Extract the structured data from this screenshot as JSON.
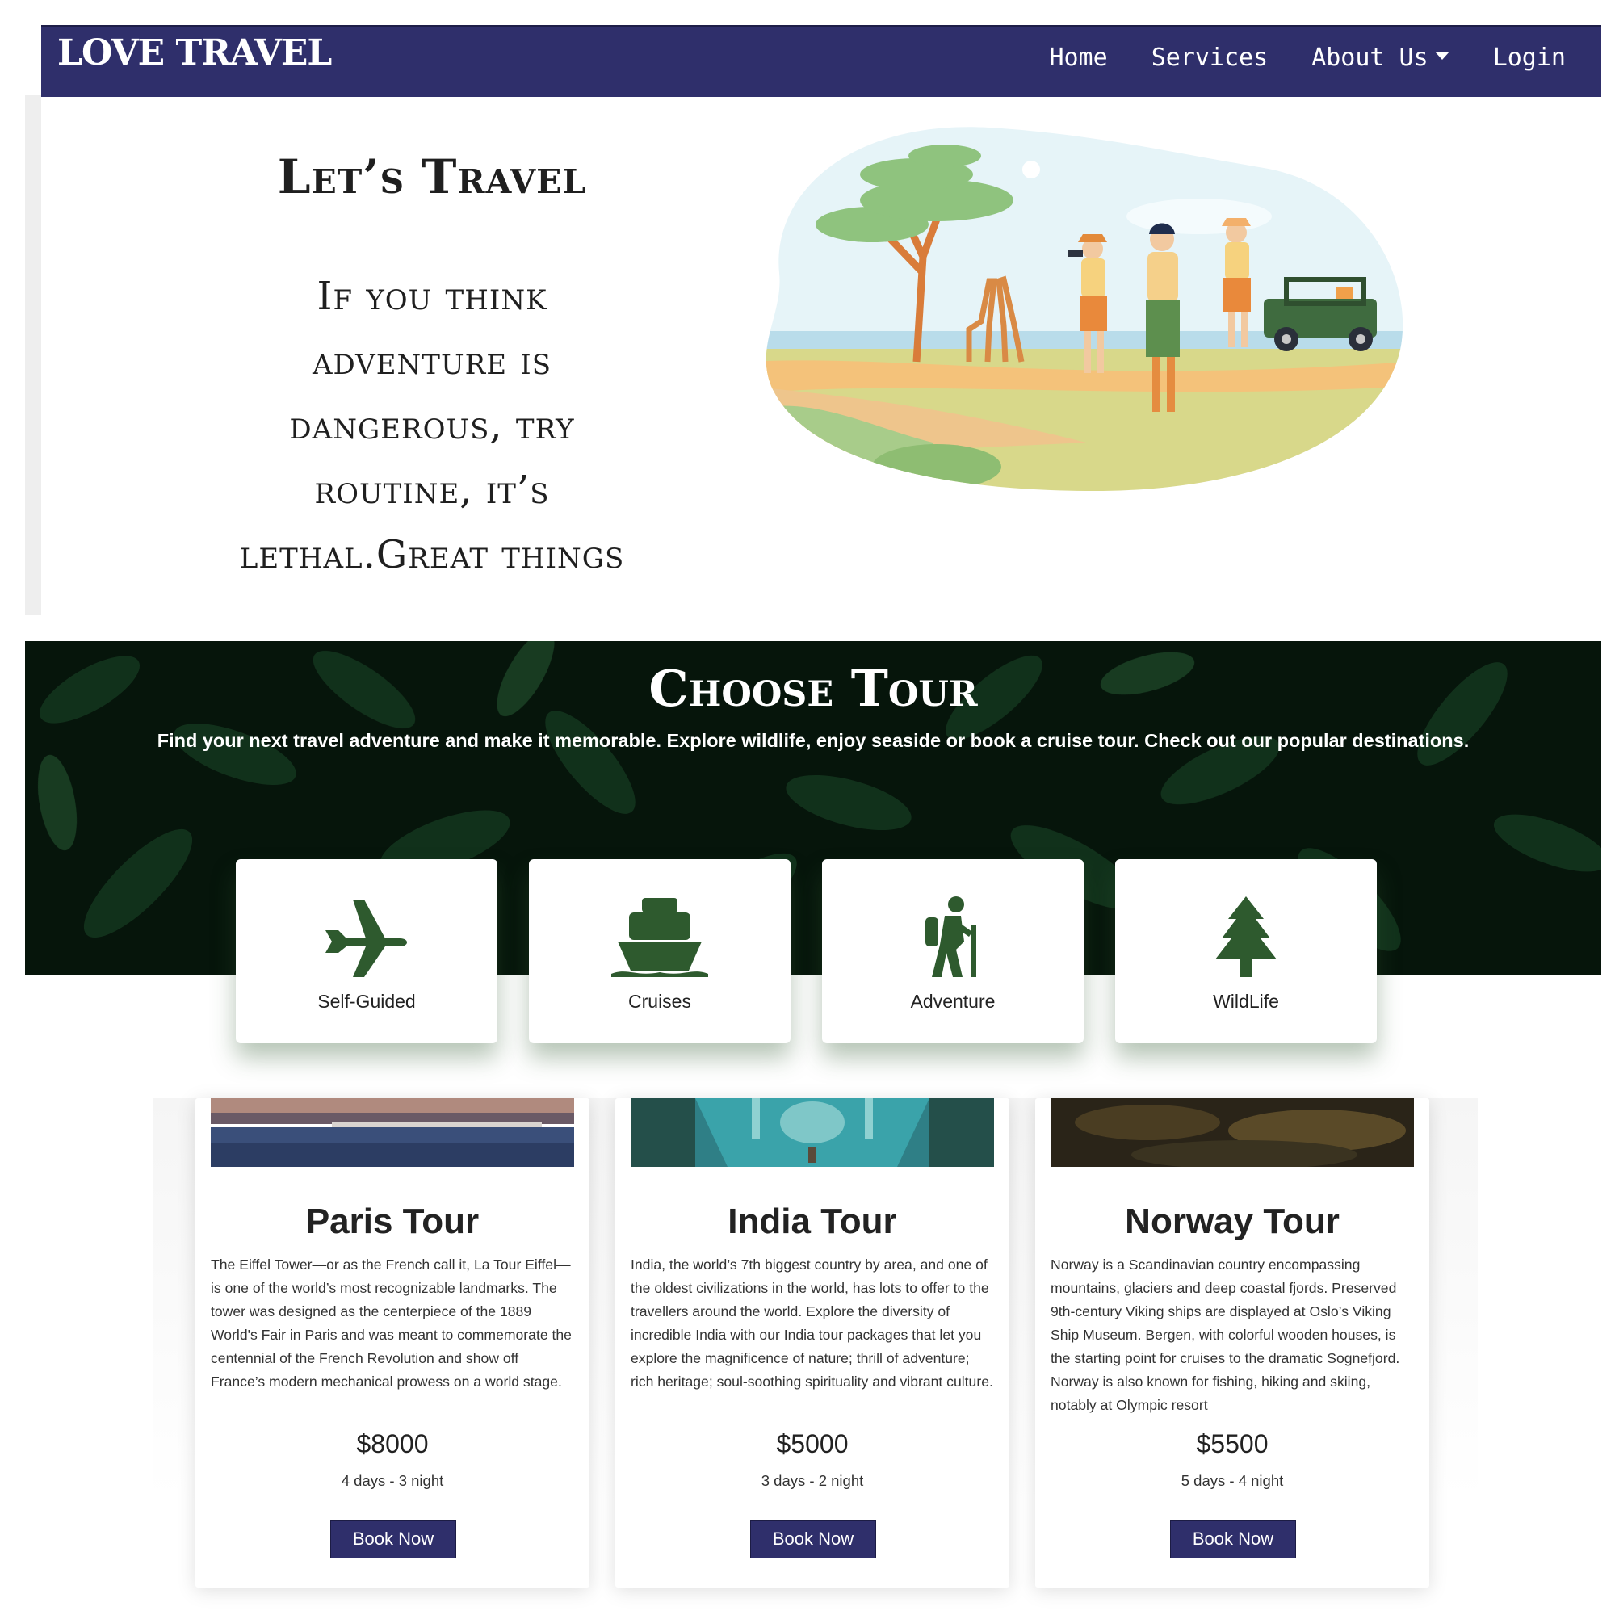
{
  "navbar": {
    "brand": "LOVE TRAVEL",
    "links": [
      "Home",
      "Services",
      "About Us",
      "Login"
    ],
    "background_color": "#2f2f6b"
  },
  "hero": {
    "title": "Let’s Travel",
    "quote_lines": [
      "If you think",
      "adventure is",
      "dangerous, try",
      "routine, it’s",
      "lethal.Great things"
    ],
    "illustration_icon": "safari-illustration"
  },
  "choose_tour": {
    "title": "Choose Tour",
    "subtitle": "Find your next travel adventure and make it memorable. Explore wildlife, enjoy seaside or book a cruise tour. Check out our popular destinations.",
    "categories": [
      {
        "label": "Self-Guided",
        "icon": "plane-icon"
      },
      {
        "label": "Cruises",
        "icon": "ship-icon"
      },
      {
        "label": "Adventure",
        "icon": "hiker-icon"
      },
      {
        "label": "WildLife",
        "icon": "tree-icon"
      }
    ],
    "icon_color": "#2e5a2e"
  },
  "tours": [
    {
      "title": "Paris Tour",
      "description": "The Eiffel Tower—or as the French call it, La Tour Eiffel—is one of the world’s most recognizable landmarks. The tower was designed as the centerpiece of the 1889 World's Fair in Paris and was meant to commemorate the centennial of the French Revolution and show off France’s modern mechanical prowess on a world stage.",
      "price": "$8000",
      "duration": "4 days - 3 night",
      "button": "Book Now",
      "image_icon": "paris-river-photo"
    },
    {
      "title": "India Tour",
      "description": "India, the world’s 7th biggest country by area, and one of the oldest civilizations in the world, has lots to offer to the travellers around the world. Explore the diversity of incredible India with our India tour packages that let you explore the magnificence of nature; thrill of adventure; rich heritage; soul-soothing spirituality and vibrant culture.",
      "price": "$5000",
      "duration": "3 days - 2 night",
      "button": "Book Now",
      "image_icon": "taj-mahal-reflection-photo"
    },
    {
      "title": "Norway Tour",
      "description": "Norway is a Scandinavian country encompassing mountains, glaciers and deep coastal fjords. Preserved 9th-century Viking ships are displayed at Oslo’s Viking Ship Museum. Bergen, with colorful wooden houses, is the starting point for cruises to the dramatic Sognefjord. Norway is also known for fishing, hiking and skiing, notably at Olympic resort",
      "price": "$5500",
      "duration": "5 days - 4 night",
      "button": "Book Now",
      "image_icon": "norway-forest-photo"
    }
  ]
}
